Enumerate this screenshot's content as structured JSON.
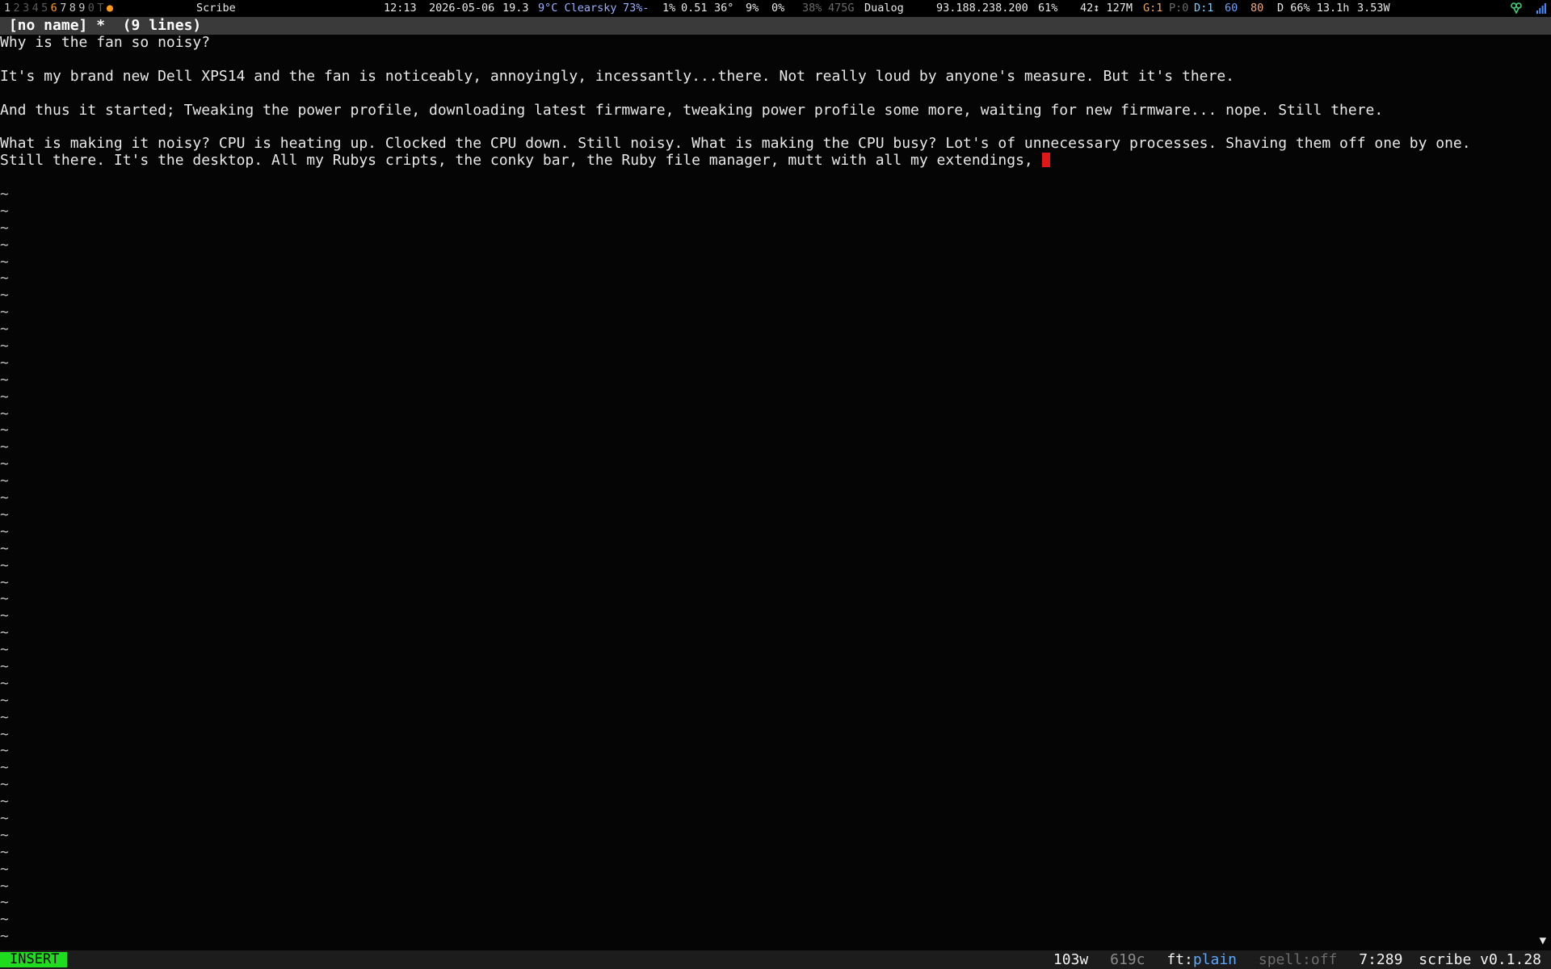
{
  "topbar": {
    "workspaces": [
      {
        "label": "1",
        "state": "used"
      },
      {
        "label": "2",
        "state": "empty"
      },
      {
        "label": "3",
        "state": "empty"
      },
      {
        "label": "4",
        "state": "empty"
      },
      {
        "label": "5",
        "state": "empty"
      },
      {
        "label": "6",
        "state": "active"
      },
      {
        "label": "7",
        "state": "used"
      },
      {
        "label": "8",
        "state": "used"
      },
      {
        "label": "9",
        "state": "used"
      },
      {
        "label": "0",
        "state": "empty"
      },
      {
        "label": "T",
        "state": "empty"
      }
    ],
    "indicator_dot": "●",
    "window_title": "Scribe",
    "time": "12:13",
    "date": "2026-05-06",
    "week": "19.3",
    "weather": "9°C Clearsky",
    "humidity": "73%-",
    "cpu": "1%",
    "load": "0.51",
    "cpu_temp": "36°",
    "mem": "9%",
    "swap": "0%",
    "disk_pct": "38%",
    "disk_size": "475G",
    "network_name": "Dualog",
    "ip": "93.188.238.200",
    "battery_level": "61%",
    "net_traffic": "42↕ 127M",
    "mail_g_label": "G:1",
    "mail_p_label": "P:0",
    "mail_d_label": "D:1",
    "num_60": "60",
    "num_80": "80",
    "power": "D 66% 13.1h",
    "watts": "3.53W",
    "tray_icons": [
      "connection-icon",
      "signal-bars-icon"
    ]
  },
  "titlebar": {
    "text": " [no name] *  (9 lines)"
  },
  "editor": {
    "lines": [
      "Why is the fan so noisy?",
      "",
      "It's my brand new Dell XPS14 and the fan is noticeably, annoyingly, incessantly...there. Not really loud by anyone's measure. But it's there.",
      "",
      "And thus it started; Tweaking the power profile, downloading latest firmware, tweaking power profile some more, waiting for new firmware... nope. Still there.",
      "",
      "What is making it noisy? CPU is heating up. Clocked the CPU down. Still noisy. What is making the CPU busy? Lot's of unnecessary processes. Shaving them off one by one.",
      "Still there. It's the desktop. All my Rubys cripts, the conky bar, the Ruby file manager, mutt with all my extendings, ",
      ""
    ],
    "empty_line_marker": "~",
    "scroll_arrow": "▼"
  },
  "statusline": {
    "mode": "INSERT",
    "words": "103w",
    "chars": "619c",
    "filetype_label": "ft:",
    "filetype_value": "plain",
    "spell": "spell:off",
    "position": "7:289",
    "app_version": "scribe v0.1.28"
  },
  "colors": {
    "mode_bg": "#1fdc1f",
    "cursor": "#e01818",
    "active_workspace": "#ff9b1a",
    "titlebar_bg": "#3a3a3a",
    "filetype_accent": "#5aa8ff"
  }
}
